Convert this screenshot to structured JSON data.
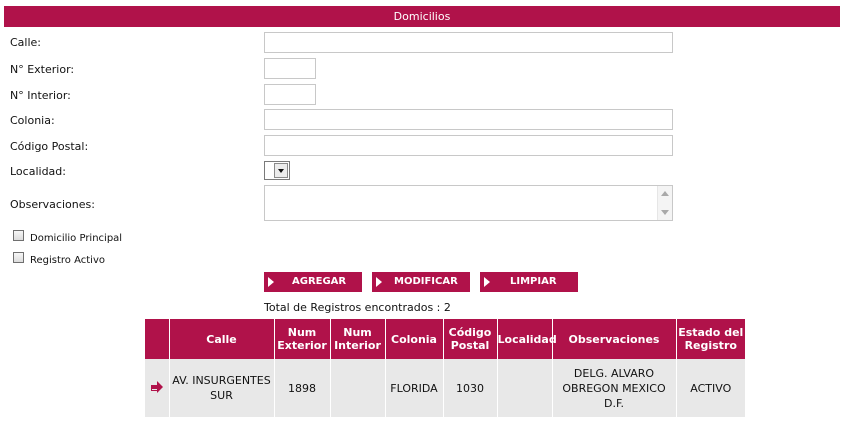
{
  "section_title": "Domicilios",
  "form": {
    "calle_label": "Calle:",
    "num_exterior_label": "N° Exterior:",
    "num_interior_label": "N° Interior:",
    "colonia_label": "Colonia:",
    "codigo_postal_label": "Código Postal:",
    "localidad_label": "Localidad:",
    "observaciones_label": "Observaciones:",
    "calle_value": "",
    "num_exterior_value": "",
    "num_interior_value": "",
    "colonia_value": "",
    "codigo_postal_value": "",
    "localidad_value": "",
    "observaciones_value": "",
    "domicilio_principal_label": "Domicilio Principal",
    "registro_activo_label": "Registro Activo",
    "domicilio_principal_checked": false,
    "registro_activo_checked": false
  },
  "buttons": {
    "agregar": "AGREGAR",
    "modificar": "MODIFICAR",
    "limpiar": "LIMPIAR"
  },
  "total_text": "Total de Registros encontrados : 2",
  "table": {
    "headers": {
      "calle": "Calle",
      "num_exterior": "Num Exterior",
      "num_interior": "Num Interior",
      "colonia": "Colonia",
      "codigo_postal": "Código Postal",
      "localidad": "Localidad",
      "observaciones": "Observaciones",
      "estado": "Estado del Registro"
    },
    "rows": [
      {
        "calle": "AV. INSURGENTES SUR",
        "num_exterior": "1898",
        "num_interior": "",
        "colonia": "FLORIDA",
        "codigo_postal": "1030",
        "localidad": "",
        "observaciones": "DELG. ALVARO OBREGON MEXICO D.F.",
        "estado": "ACTIVO"
      }
    ]
  },
  "colors": {
    "accent": "#b0124a",
    "row_bg": "#e8e8e8"
  },
  "icons": {
    "row_selector": "arrow-right-icon",
    "button_bullet": "triangle-right-icon",
    "select_arrow": "chevron-down-icon"
  }
}
